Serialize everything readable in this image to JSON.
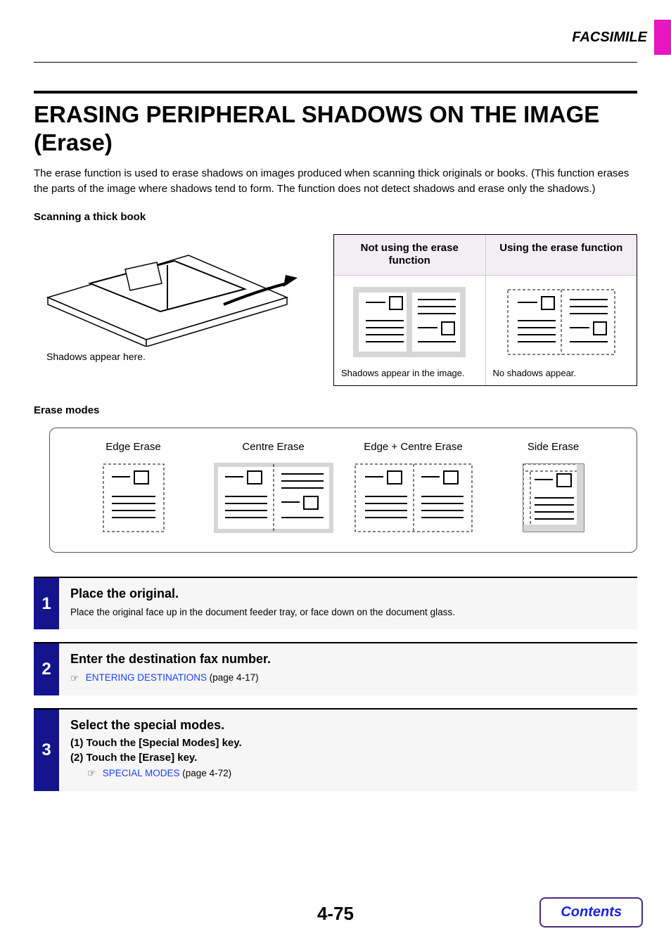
{
  "header": {
    "section": "FACSIMILE"
  },
  "title": "ERASING PERIPHERAL SHADOWS ON THE IMAGE (Erase)",
  "intro": "The erase function is used to erase shadows on images produced when scanning thick originals or books. (This function erases the parts of the image where shadows tend to form. The function does not detect shadows and erase only the shadows.)",
  "sub1": "Scanning a thick book",
  "book_caption": "Shadows appear here.",
  "compare": {
    "col1_head": "Not using the erase function",
    "col2_head": "Using the erase function",
    "col1_cap": "Shadows appear in the image.",
    "col2_cap": "No shadows appear."
  },
  "sub2": "Erase modes",
  "modes": {
    "m1": "Edge Erase",
    "m2": "Centre Erase",
    "m3": "Edge + Centre Erase",
    "m4": "Side Erase"
  },
  "steps": {
    "s1": {
      "num": "1",
      "title": "Place the original.",
      "text": "Place the original face up in the document feeder tray, or face down on the document glass."
    },
    "s2": {
      "num": "2",
      "title": "Enter the destination fax number.",
      "link_text": "ENTERING DESTINATIONS",
      "link_suffix": " (page 4-17)"
    },
    "s3": {
      "num": "3",
      "title": "Select the special modes.",
      "sub1": "(1)  Touch the [Special Modes] key.",
      "sub2": "(2)  Touch the [Erase] key.",
      "link_text": "SPECIAL MODES",
      "link_suffix": " (page 4-72)"
    }
  },
  "page_number": "4-75",
  "contents": "Contents"
}
